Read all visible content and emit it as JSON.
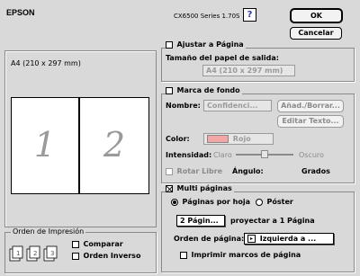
{
  "header": {
    "brand": "EPSON",
    "model": "CX6500 Series 1.70S",
    "help": "?"
  },
  "buttons": {
    "ok": "OK",
    "cancel": "Cancelar"
  },
  "preview": {
    "paper_label": "A4 (210 x 297 mm)",
    "page1": "1",
    "page2": "2"
  },
  "print_order": {
    "title": "Orden de Impresión",
    "collate": "Comparar",
    "reverse": "Orden Inverso"
  },
  "fit_to_page": {
    "label": "Ajustar a Página",
    "paper_size_label": "Tamaño del papel de salida:",
    "paper_size_value": "A4 (210 x 297 mm)"
  },
  "watermark": {
    "label": "Marca de fondo",
    "name_label": "Nombre:",
    "name_value": "Confidenci...",
    "add_delete": "Añad./Borrar...",
    "edit_text": "Editar Texto...",
    "color_label": "Color:",
    "color_value": "Rojo",
    "intensity_label": "Intensidad:",
    "light": "Claro",
    "dark": "Oscuro",
    "rotate_free": "Rotar Libre",
    "angle_label": "Ángulo:",
    "degrees": "Grados",
    "swatch_color": "#f2a6a6"
  },
  "multipage": {
    "label": "Multi páginas",
    "pages_per_sheet": "Páginas por hoja",
    "poster": "Póster",
    "count_value": "2 Págin...",
    "project_label": "proyectar a 1 Página",
    "order_label": "Orden de página:",
    "order_value": "Izquierda a ...",
    "print_borders": "Imprimir marcos de página"
  }
}
